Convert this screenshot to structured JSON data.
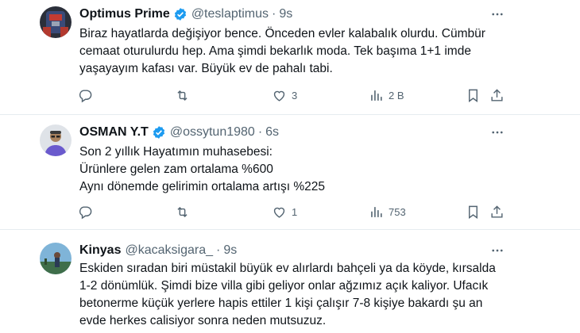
{
  "tweets": [
    {
      "name": "Optimus Prime",
      "handle": "@teslaptimus",
      "time": "9s",
      "verified": true,
      "lines": [
        "Biraz hayatlarda değişiyor bence. Önceden evler kalabalık olurdu. Cümbür",
        "cemaat oturulurdu hep. Ama şimdi bekarlık moda. Tek başıma 1+1 imde",
        "yaşayayım kafası var. Büyük ev de pahalı tabi."
      ],
      "replies": "",
      "retweets": "",
      "likes": "3",
      "views": "2 B"
    },
    {
      "name": "OSMAN Y.T",
      "handle": "@ossytun1980",
      "time": "6s",
      "verified": true,
      "lines": [
        "Son 2 yıllık  Hayatımın muhasebesi:",
        "Ürünlere gelen zam ortalama   %600",
        "Aynı  dönemde  gelirimin ortalama  artışı %225"
      ],
      "replies": "",
      "retweets": "",
      "likes": "1",
      "views": "753"
    },
    {
      "name": "Kinyas",
      "handle": "@kacaksigara_",
      "time": "9s",
      "verified": false,
      "lines": [
        "Eskiden sıradan biri müstakil büyük ev alırlardı bahçeli ya da köyde, kırsalda",
        "1-2 dönümlük. Şimdi bize villa gibi geliyor onlar ağzımız açık kaliyor. Ufacık",
        "betonerme küçük yerlere hapis ettiler 1 kişi çalışır 7-8 kişiye bakardı şu an",
        "evde herkes calisiyor sonra neden mutsuzuz."
      ],
      "replies": "",
      "retweets": "",
      "likes": "",
      "views": ""
    }
  ],
  "colors": {
    "verified": "#1d9bf0",
    "muted": "#536471",
    "text": "#0f1419"
  }
}
